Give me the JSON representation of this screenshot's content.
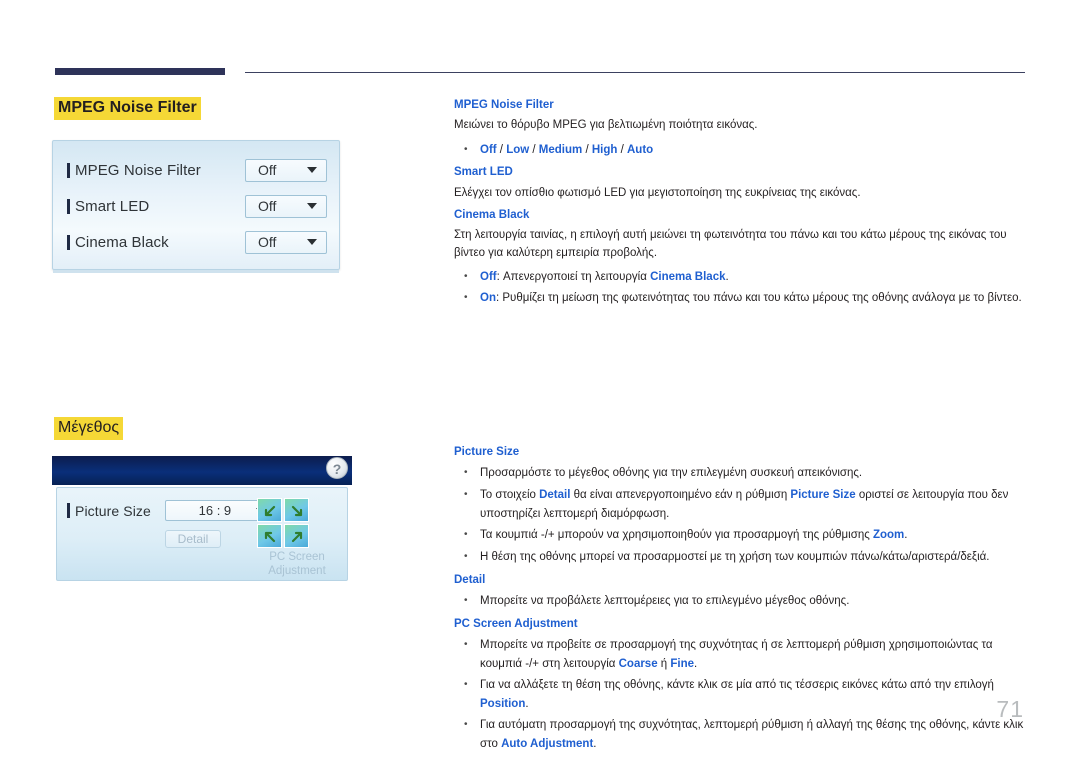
{
  "page": {
    "number": "71"
  },
  "sections": [
    {
      "heading": "MPEG Noise Filter"
    },
    {
      "heading": "Μέγεθος"
    }
  ],
  "osd_panel_mpeg": {
    "rows": [
      {
        "label": "MPEG Noise Filter",
        "value": "Off"
      },
      {
        "label": "Smart LED",
        "value": "Off"
      },
      {
        "label": "Cinema Black",
        "value": "Off"
      }
    ]
  },
  "osd_panel_picture_size": {
    "help_label": "?",
    "row_label": "Picture Size",
    "row_value": "16 : 9",
    "detail_button": "Detail",
    "position_label": "PC Screen Adjustment"
  },
  "content": {
    "mpeg_noise_filter": {
      "heading": "MPEG Noise Filter",
      "description": "Μειώνει το θόρυβο MPEG για βελτιωμένη ποιότητα εικόνας.",
      "options_prefix": "",
      "options": [
        "Off",
        "Low",
        "Medium",
        "High",
        "Auto"
      ],
      "options_separator": " / "
    },
    "smart_led": {
      "heading": "Smart LED",
      "description": "Ελέγχει τον οπίσθιο φωτισμό LED για μεγιστοποίηση της ευκρίνειας της εικόνας."
    },
    "cinema_black": {
      "heading": "Cinema Black",
      "description": "Στη λειτουργία ταινίας, η επιλογή αυτή μειώνει τη φωτεινότητα του πάνω και του κάτω μέρους της εικόνας του βίντεο για καλύτερη εμπειρία προβολής.",
      "bullet_off_key": "Off",
      "bullet_off_text_1": ": Απενεργοποιεί τη λειτουργία ",
      "bullet_off_link": "Cinema Black",
      "bullet_off_text_2": ".",
      "bullet_on_key": "On",
      "bullet_on_text": ": Ρυθμίζει τη μείωση της φωτεινότητας του πάνω και του κάτω μέρους της οθόνης ανάλογα με το βίντεο."
    },
    "picture_size": {
      "heading": "Picture Size",
      "bullet1": "Προσαρμόστε το μέγεθος οθόνης για την επιλεγμένη συσκευή απεικόνισης.",
      "bullet2_a": "Το στοιχείο ",
      "bullet2_link1": "Detail",
      "bullet2_b": " θα είναι απενεργοποιημένο εάν η ρύθμιση ",
      "bullet2_link2": "Picture Size",
      "bullet2_c": " οριστεί σε λειτουργία που δεν υποστηρίζει λεπτομερή διαμόρφωση.",
      "bullet3_a": "Τα κουμπιά -/+ μπορούν να χρησιμοποιηθούν για προσαρμογή της ρύθμισης ",
      "bullet3_link": "Zoom",
      "bullet3_b": ".",
      "bullet4": "Η θέση της οθόνης μπορεί να προσαρμοστεί με τη χρήση των κουμπιών πάνω/κάτω/αριστερά/δεξιά."
    },
    "detail": {
      "heading": "Detail",
      "bullet1": "Μπορείτε να προβάλετε λεπτομέρειες για το επιλεγμένο μέγεθος οθόνης."
    },
    "pc_screen_adjustment": {
      "heading": "PC Screen Adjustment",
      "bullet1_a": "Μπορείτε να προβείτε σε προσαρμογή της συχνότητας ή σε λεπτομερή ρύθμιση χρησιμοποιώντας τα κουμπιά -/+ στη λειτουργία ",
      "bullet1_link1": "Coarse",
      "bullet1_b": " ή ",
      "bullet1_link2": "Fine",
      "bullet1_c": ".",
      "bullet2_a": "Για να αλλάξετε τη θέση της οθόνης, κάντε κλικ σε μία από τις τέσσερις εικόνες κάτω από την επιλογή ",
      "bullet2_link": "Position",
      "bullet2_b": ".",
      "bullet3_a": "Για αυτόματη προσαρμογή της συχνότητας, λεπτομερή ρύθμιση ή αλλαγή της θέσης της οθόνης, κάντε κλικ στο ",
      "bullet3_link": "Auto Adjustment",
      "bullet3_b": "."
    }
  },
  "colors": {
    "highlight": "#f5d836",
    "link_blue": "#1f5fd0",
    "header_bar": "#2e3359",
    "osd_title_bar": "#0a2f7a"
  }
}
